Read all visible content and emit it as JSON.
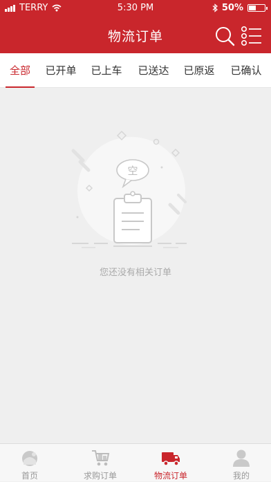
{
  "status_bar": {
    "carrier": "TERRY",
    "time": "5:30 PM",
    "battery": "50%",
    "battery_level": 0.5,
    "icons": [
      "signal-icon",
      "wifi-icon",
      "bluetooth-icon",
      "battery-icon"
    ]
  },
  "header": {
    "title": "物流订单",
    "background_color": "#c9262c",
    "icons": [
      "search-icon",
      "list-menu-icon"
    ]
  },
  "tabs": [
    {
      "label": "全部",
      "active": true
    },
    {
      "label": "已开单",
      "active": false
    },
    {
      "label": "已上车",
      "active": false
    },
    {
      "label": "已送达",
      "active": false
    },
    {
      "label": "已原返",
      "active": false
    },
    {
      "label": "已确认",
      "active": false
    }
  ],
  "empty_state": {
    "bubble_text": "空",
    "message": "您还没有相关订单",
    "icon": "empty-clipboard-icon"
  },
  "tabbar": {
    "items": [
      {
        "label": "首页",
        "icon": "home-icon",
        "active": false
      },
      {
        "label": "求购订单",
        "icon": "cart-icon",
        "active": false
      },
      {
        "label": "物流订单",
        "icon": "truck-icon",
        "active": true
      },
      {
        "label": "我的",
        "icon": "user-icon",
        "active": false
      }
    ],
    "active_color": "#c9262c"
  }
}
